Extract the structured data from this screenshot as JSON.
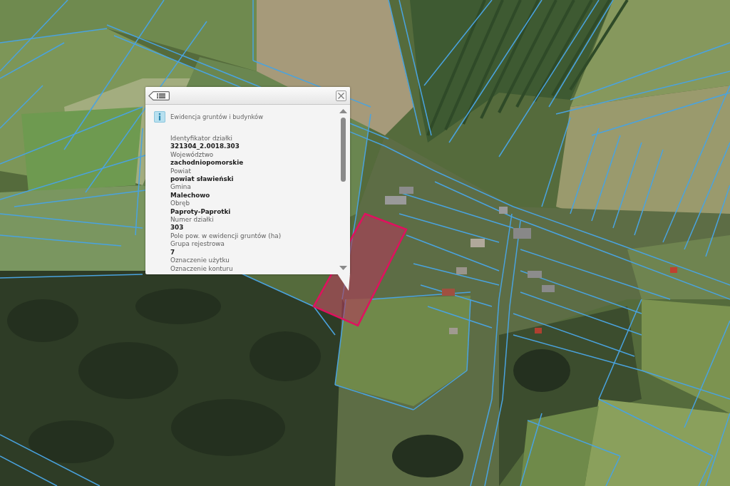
{
  "popup": {
    "title": "Ewidencja gruntów i budynków",
    "attributes": [
      {
        "label": "Identyfikator działki",
        "value": "321304_2.0018.303"
      },
      {
        "label": "Województwo",
        "value": "zachodniopomorskie"
      },
      {
        "label": "Powiat",
        "value": "powiat sławieński"
      },
      {
        "label": "Gmina",
        "value": "Malechowo"
      },
      {
        "label": "Obręb",
        "value": "Paproty-Paprotki"
      },
      {
        "label": "Numer działki",
        "value": "303"
      },
      {
        "label": "Pole pow. w ewidencji gruntów (ha)"
      },
      {
        "label": "Grupa rejestrowa",
        "value": "7"
      },
      {
        "label": "Oznaczenie użytku"
      },
      {
        "label": "Oznaczenie konturu"
      }
    ]
  }
}
